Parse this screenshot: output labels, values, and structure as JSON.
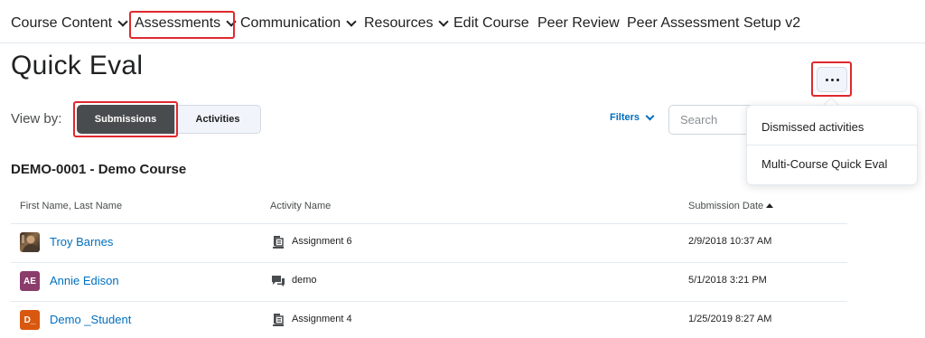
{
  "nav": {
    "items": [
      {
        "label": "Course Content",
        "dropdown": true
      },
      {
        "label": "Assessments",
        "dropdown": true
      },
      {
        "label": "Communication",
        "dropdown": true
      },
      {
        "label": "Resources",
        "dropdown": true
      },
      {
        "label": "Edit Course",
        "dropdown": false
      },
      {
        "label": "Peer Review",
        "dropdown": false
      },
      {
        "label": "Peer Assessment Setup v2",
        "dropdown": false
      }
    ]
  },
  "page": {
    "title": "Quick Eval"
  },
  "toolbar": {
    "view_by_label": "View by:",
    "view_options": [
      "Submissions",
      "Activities"
    ],
    "selected_view": "Submissions",
    "filters_label": "Filters",
    "search_placeholder": "Search",
    "more_icon": "ellipsis-icon"
  },
  "more_menu": {
    "items": [
      "Dismissed activities",
      "Multi-Course Quick Eval"
    ]
  },
  "course": {
    "heading": "DEMO-0001 - Demo Course"
  },
  "table": {
    "columns": [
      "First Name, Last Name",
      "Activity Name",
      "Submission Date"
    ],
    "sorted_column": "Submission Date",
    "sort_direction": "ascending",
    "rows": [
      {
        "avatar_type": "photo",
        "initials": "",
        "avatar_color": "#5a4330",
        "name": "Troy Barnes",
        "activity_icon": "assignment-icon",
        "activity": "Assignment 6",
        "date": "2/9/2018 10:37 AM"
      },
      {
        "avatar_type": "initials",
        "initials": "AE",
        "avatar_color": "#8a3d6b",
        "name": "Annie Edison",
        "activity_icon": "discussion-icon",
        "activity": "demo",
        "date": "5/1/2018 3:21 PM"
      },
      {
        "avatar_type": "initials",
        "initials": "D_",
        "avatar_color": "#d9580f",
        "name": "Demo _Student",
        "activity_icon": "assignment-icon",
        "activity": "Assignment 4",
        "date": "1/25/2019 8:27 AM"
      }
    ]
  },
  "colors": {
    "link": "#006fbf",
    "highlight": "#e0282e",
    "selected_segment": "#494c4e"
  }
}
